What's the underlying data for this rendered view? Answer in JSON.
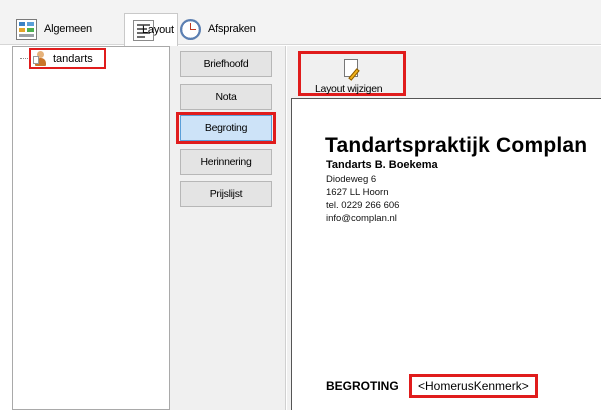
{
  "tabs": [
    {
      "label": "Algemeen",
      "icon": "grid-icon"
    },
    {
      "label": "Layout",
      "icon": "document-icon",
      "active": true
    },
    {
      "label": "Afspraken",
      "icon": "clock-icon"
    }
  ],
  "tree": {
    "items": [
      {
        "label": "tandarts",
        "icon": "user-icon"
      }
    ]
  },
  "layout_sections": [
    {
      "label": "Briefhoofd"
    },
    {
      "label": "Nota"
    },
    {
      "label": "Begroting",
      "selected": true
    },
    {
      "label": "Herinnering"
    },
    {
      "label": "Prijslijst"
    }
  ],
  "toolbar": {
    "layout_button_label": "Layout wijzigen",
    "icon": "edit-document-icon"
  },
  "document": {
    "practice_name": "Tandartspraktijk Complan",
    "dentist": "Tandarts B. Boekema",
    "address_lines": [
      "Diodeweg 6",
      "1627 LL Hoorn",
      "tel. 0229 266 606",
      "info@complan.nl"
    ],
    "section_title": "BEGROTING",
    "field_placeholder": "<HomerusKenmerk>"
  },
  "colors": {
    "highlight": "#e01c1c",
    "selected_button": "#cde3f8"
  }
}
